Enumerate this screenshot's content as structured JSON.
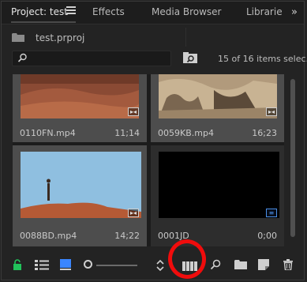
{
  "tabs": [
    {
      "label": "Project: test",
      "active": true
    },
    {
      "label": "Effects",
      "active": false
    },
    {
      "label": "Media Browser",
      "active": false
    },
    {
      "label": "Librarie",
      "active": false
    }
  ],
  "overflow_icon": "double-chevron-right",
  "project": {
    "filename": "test.prproj"
  },
  "search": {
    "value": "",
    "placeholder": ""
  },
  "selection_count": "15 of 16 items selec...",
  "clips": [
    {
      "name": "0110FN.mp4",
      "duration": "11;14",
      "selected": true,
      "badge": "video-audio"
    },
    {
      "name": "0059KB.mp4",
      "duration": "16;23",
      "selected": true,
      "badge": "video-audio"
    },
    {
      "name": "0088BD.mp4",
      "duration": "14;22",
      "selected": true,
      "badge": "video-audio"
    },
    {
      "name": "0001JD",
      "duration": "0;00",
      "selected": false,
      "badge": "sequence"
    }
  ],
  "colors": {
    "accent_blue": "#3a86ff",
    "lock_green": "#21c25a",
    "annotation_red": "#f00c0c"
  },
  "toolbar_icons": [
    "lock-icon",
    "list-view-icon",
    "icon-view-icon",
    "zoom-slider",
    "sort-icon",
    "automate-to-sequence-icon",
    "find-icon",
    "new-bin-icon",
    "new-item-icon",
    "trash-icon"
  ]
}
